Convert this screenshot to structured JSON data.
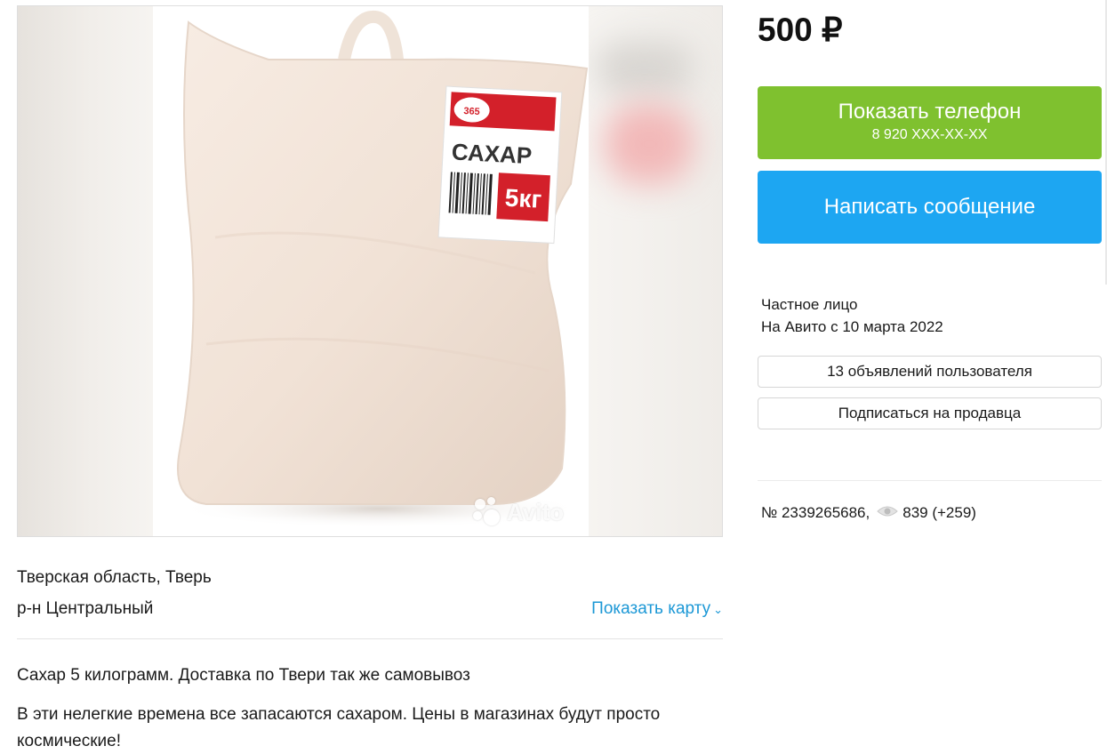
{
  "listing": {
    "price": "500 ₽",
    "image": {
      "bag_label": "САХАР",
      "weight_label": "5кг",
      "brand_badge": "365",
      "watermark": "Avito"
    }
  },
  "location": {
    "region": "Тверская область, Тверь",
    "district": "р-н Центральный",
    "show_map_label": "Показать карту",
    "show_map_icon": "chevron-down-icon"
  },
  "description": {
    "line1": "Сахар 5 килограмм. Доставка по Твери так же самовывоз",
    "line2": "В эти нелегкие времена все запасаются сахаром. Цены в магазинах будут просто космические!"
  },
  "actions": {
    "show_phone_label": "Показать телефон",
    "phone_masked": "8 920 XXX-XX-XX",
    "message_label": "Написать сообщение"
  },
  "seller": {
    "type": "Частное лицо",
    "since": "На Авито с 10 марта 2022",
    "listings_button": "13 объявлений пользователя",
    "subscribe_button": "Подписаться на продавца"
  },
  "meta": {
    "ad_number": "№ 2339265686,",
    "views": "839 (+259)",
    "views_icon": "eye-icon"
  },
  "colors": {
    "phone_button": "#7fc12f",
    "message_button": "#1da6f2",
    "link": "#1c98d6",
    "label_red": "#d3202a"
  }
}
